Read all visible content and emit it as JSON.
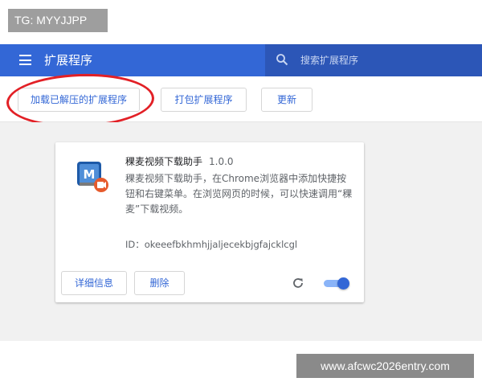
{
  "tg_badge": "TG: MYYJJPP",
  "header": {
    "title": "扩展程序",
    "search_placeholder": "搜索扩展程序",
    "accent_color": "#3367d6"
  },
  "toolbar": {
    "load_unpacked_label": "加载已解压的扩展程序",
    "pack_label": "打包扩展程序",
    "update_label": "更新"
  },
  "extension": {
    "name": "稞麦视频下载助手",
    "version": "1.0.0",
    "description": "稞麦视频下载助手，在Chrome浏览器中添加快捷按钮和右键菜单。在浏览网页的时候，可以快速调用“稞麦”下载视频。",
    "id_text": "ID：okeeefbkhmhjjaljecekbjgfajcklcgl",
    "details_label": "详细信息",
    "remove_label": "删除",
    "enabled": true,
    "icon": "xmeye-icon"
  },
  "watermark": "www.afcwc2026entry.com"
}
